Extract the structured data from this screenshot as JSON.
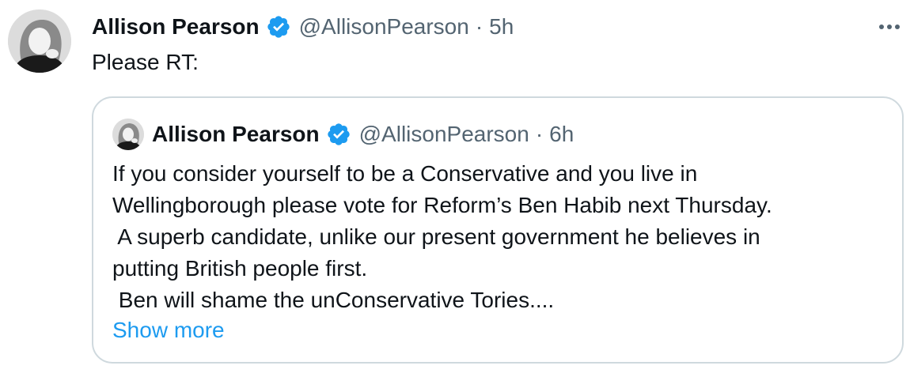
{
  "tweet": {
    "author_name": "Allison Pearson",
    "handle": "@AllisonPearson",
    "separator": "·",
    "time": "5h",
    "text": "Please RT:",
    "more_icon": "ellipsis-icon",
    "avatar_icon": "profile-photo"
  },
  "quoted": {
    "author_name": "Allison Pearson",
    "handle": "@AllisonPearson",
    "separator": "·",
    "time": "6h",
    "lines": [
      "If you consider yourself to be a Conservative and you live in",
      "Wellingborough please vote for Reform’s Ben Habib next Thursday.",
      " A superb candidate, unlike our present government he believes in",
      "putting British people first.",
      " Ben will shame the unConservative Tories...."
    ],
    "show_more": "Show more"
  },
  "colors": {
    "verified": "#1d9bf0",
    "link": "#1d9bf0",
    "secondary_text": "#536471",
    "border": "#cfd9de"
  }
}
